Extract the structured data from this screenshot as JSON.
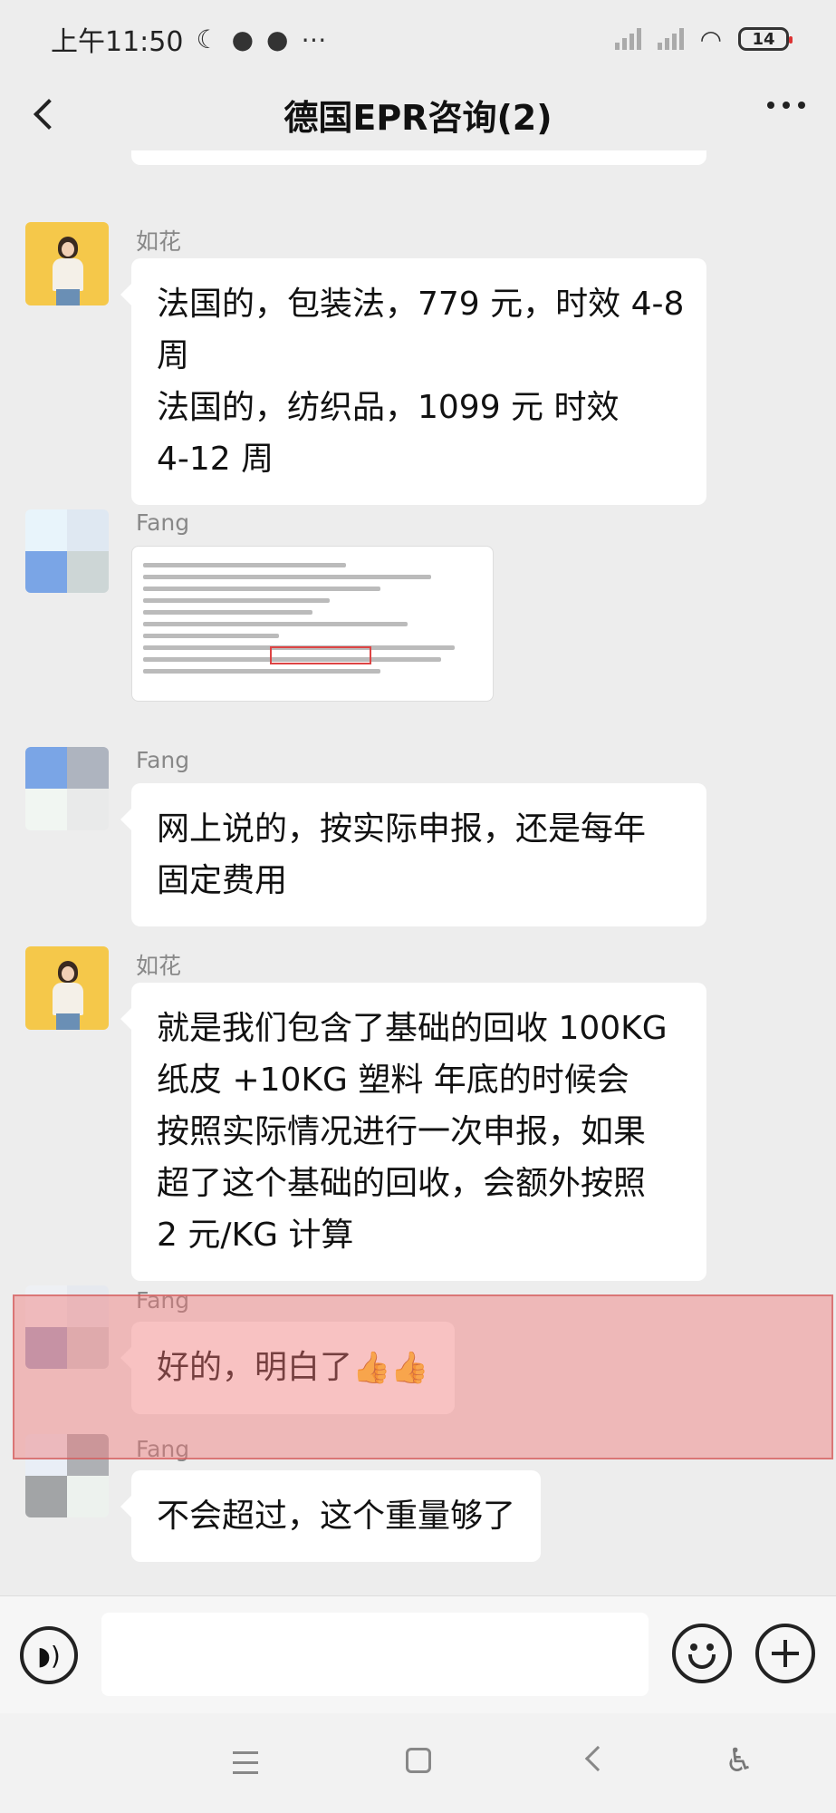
{
  "status_bar": {
    "time": "上午11:50",
    "icons": [
      "moon-icon",
      "wechat-icon",
      "wechat-icon",
      "more-dots-icon"
    ],
    "battery_level": "14"
  },
  "header": {
    "title": "德国EPR咨询(2)",
    "back_icon": "chevron-left-icon",
    "more_icon": "more-horizontal-icon"
  },
  "messages": [
    {
      "sender": "如花",
      "avatar": "girl-avatar",
      "lines": [
        "法国的，包装法，779 元，时效 4-8",
        "周",
        "法国的，纺织品，1099 元   时效",
        "4-12 周"
      ]
    },
    {
      "sender": "Fang",
      "avatar": "blurred-avatar",
      "type": "image"
    },
    {
      "sender": "Fang",
      "avatar": "blurred-avatar",
      "lines": [
        "网上说的，按实际申报，还是每年",
        "固定费用"
      ]
    },
    {
      "sender": "如花",
      "avatar": "girl-avatar",
      "lines": [
        "就是我们包含了基础的回收 100KG",
        "纸皮 +10KG 塑料     年底的时候会",
        "按照实际情况进行一次申报，如果",
        "超了这个基础的回收，会额外按照",
        "2 元/KG 计算"
      ]
    },
    {
      "sender": "Fang",
      "avatar": "blurred-avatar",
      "lines": [
        "好的，明白了"
      ],
      "emoji": "👍👍",
      "highlighted": true
    },
    {
      "sender": "Fang",
      "avatar": "blurred-avatar",
      "lines": [
        "不会超过，这个重量够了"
      ]
    }
  ],
  "input_bar": {
    "voice_icon": "voice-icon",
    "emoji_icon": "emoji-icon",
    "plus_icon": "plus-icon",
    "placeholder": ""
  },
  "nav_bar": {
    "icons": [
      "menu-icon",
      "home-icon",
      "back-icon",
      "accessibility-icon"
    ]
  },
  "colors": {
    "background": "#ededed",
    "bubble": "#ffffff",
    "highlight": "#f08a8a"
  }
}
